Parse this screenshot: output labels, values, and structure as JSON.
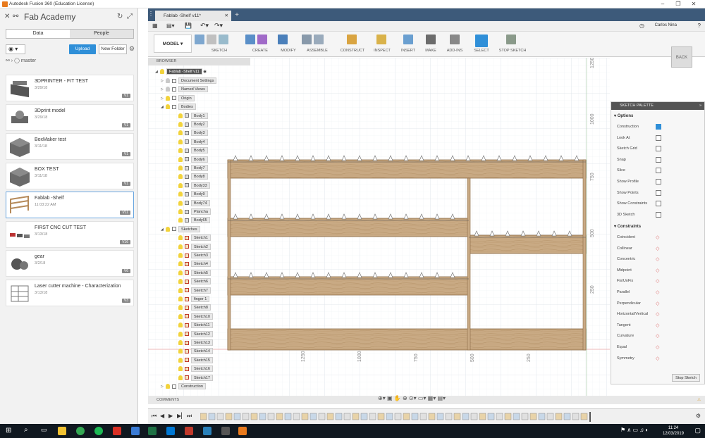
{
  "window": {
    "title": "Autodesk Fusion 360 (Education License)"
  },
  "datapanel": {
    "project": "Fab Academy",
    "tabs": [
      "Data",
      "People"
    ],
    "upload": "Upload",
    "new_folder": "New Folder",
    "breadcrumb": "master",
    "files": [
      {
        "name": "3DPRINTER - FIT TEST",
        "date": "3/29/18",
        "ver": "V1"
      },
      {
        "name": "3Dprint model",
        "date": "3/29/18",
        "ver": "V1"
      },
      {
        "name": "BoxMaker test",
        "date": "3/11/18",
        "ver": "V1"
      },
      {
        "name": "BOX TEST",
        "date": "3/11/18",
        "ver": "V1"
      },
      {
        "name": "Fablab -Shelf",
        "date": "11:03:22 AM",
        "ver": "V11"
      },
      {
        "name": "FIRST CNC CUT TEST",
        "date": "3/13/18",
        "ver": "V16"
      },
      {
        "name": "gear",
        "date": "3/2/18",
        "ver": "V6"
      },
      {
        "name": "Laser cutter machine - Characterization",
        "date": "3/13/18",
        "ver": "V3"
      }
    ]
  },
  "doctab": {
    "label": "Fablab -Shelf v11*"
  },
  "user": "Carlos Nina",
  "toolbar": {
    "mode": "MODEL",
    "groups": [
      "SKETCH",
      "CREATE",
      "MODIFY",
      "ASSEMBLE",
      "CONSTRUCT",
      "INSPECT",
      "INSERT",
      "MAKE",
      "ADD-INS",
      "SELECT",
      "STOP SKETCH"
    ]
  },
  "browser": {
    "head": "BROWSER",
    "root": "Fablab -Shelf v11",
    "folders": [
      "Document Settings",
      "Named Views",
      "Origin",
      "Bodies"
    ],
    "bodies": [
      "Body1",
      "Body2",
      "Body3",
      "Body4",
      "Body5",
      "Body6",
      "Body7",
      "Body8",
      "Body33",
      "Body9",
      "Body74",
      "Plancha",
      "Body65"
    ],
    "sketches_label": "Sketches",
    "sketches": [
      "Sketch1",
      "Sketch2",
      "Sketch3",
      "Sketch4",
      "Sketch5",
      "Sketch6",
      "Sketch7",
      "finger 1",
      "Sketch8",
      "Sketch10",
      "Sketch11",
      "Sketch12",
      "Sketch13",
      "Sketch14",
      "Sketch15",
      "Sketch16",
      "Sketch17"
    ],
    "construction": "Construction"
  },
  "canvas": {
    "back": "BACK",
    "hlabels": [
      "1250",
      "1000",
      "750",
      "500",
      "250"
    ],
    "vlabels": [
      "1250",
      "1000",
      "750",
      "500",
      "250"
    ]
  },
  "palette": {
    "title": "SKETCH PALETTE",
    "options_label": "Options",
    "options": [
      "Construction",
      "Look At",
      "Sketch Grid",
      "Snap",
      "Slice",
      "Show Profile",
      "Show Points",
      "Show Constraints",
      "3D Sketch"
    ],
    "constraints_label": "Constraints",
    "constraints": [
      "Coincident",
      "Collinear",
      "Concentric",
      "Midpoint",
      "Fix/UnFix",
      "Parallel",
      "Perpendicular",
      "Horizontal/Vertical",
      "Tangent",
      "Curvature",
      "Equal",
      "Symmetry"
    ],
    "stop": "Stop Sketch"
  },
  "comments": "COMMENTS",
  "clock": {
    "time": "11:24",
    "date": "12/03/2019"
  }
}
